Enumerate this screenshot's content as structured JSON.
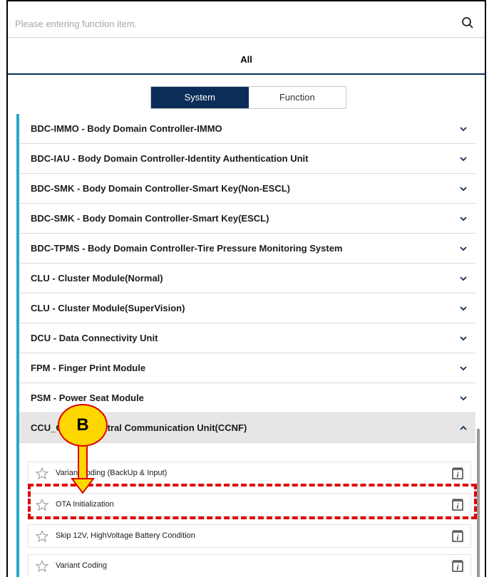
{
  "search": {
    "placeholder": "Please entering function item."
  },
  "tabs": {
    "all_label": "All"
  },
  "toggle": {
    "system_label": "System",
    "function_label": "Function",
    "active": "System"
  },
  "systems": [
    {
      "label": "BDC-IMMO - Body Domain Controller-IMMO",
      "expanded": false
    },
    {
      "label": "BDC-IAU - Body Domain Controller-Identity Authentication Unit",
      "expanded": false
    },
    {
      "label": "BDC-SMK - Body Domain Controller-Smart Key(Non-ESCL)",
      "expanded": false
    },
    {
      "label": "BDC-SMK - Body Domain Controller-Smart Key(ESCL)",
      "expanded": false
    },
    {
      "label": "BDC-TPMS - Body Domain Controller-Tire Pressure Monitoring System",
      "expanded": false
    },
    {
      "label": "CLU - Cluster Module(Normal)",
      "expanded": false
    },
    {
      "label": "CLU - Cluster Module(SuperVision)",
      "expanded": false
    },
    {
      "label": "DCU - Data Connectivity Unit",
      "expanded": false
    },
    {
      "label": "FPM - Finger Print Module",
      "expanded": false
    },
    {
      "label": "PSM - Power Seat Module",
      "expanded": false
    },
    {
      "label": "CCU_CCNF - Central Communication Unit(CCNF)",
      "expanded": true
    }
  ],
  "functions": [
    {
      "label": "Variant coding (BackUp & Input)"
    },
    {
      "label": "OTA Initialization"
    },
    {
      "label": "Skip 12V, HighVoltage Battery Condition"
    },
    {
      "label": "Variant Coding"
    }
  ],
  "callout": {
    "label": "B"
  },
  "colors": {
    "accent": "#0c2d57",
    "list_bar": "#2aa8c7",
    "highlight": "#e00000",
    "callout_fill": "#ffd700"
  }
}
